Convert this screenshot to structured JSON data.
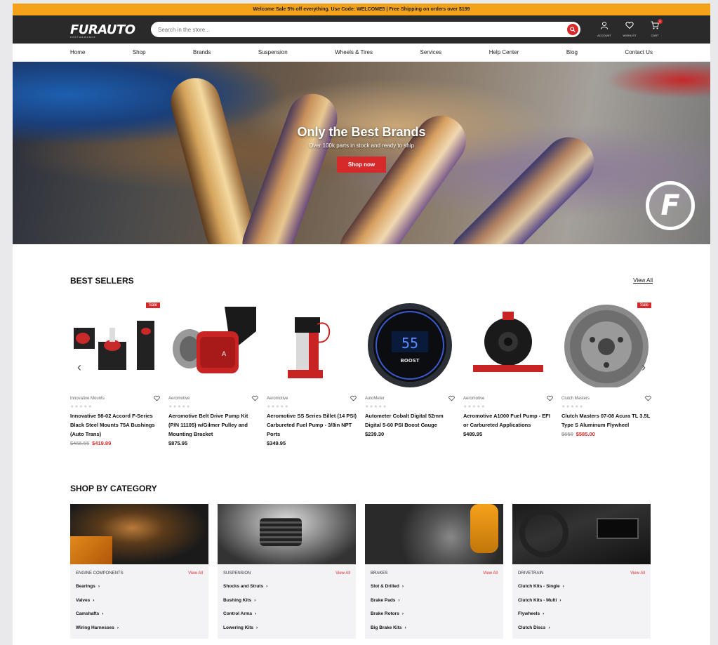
{
  "promo": {
    "text": "Welcome Sale 5% off everything. Use Code: WELCOME5 | Free Shipping on orders over $199"
  },
  "header": {
    "logo": "FURAUTO",
    "logo_tag": "PERFORMANCE",
    "search_placeholder": "Search in the store...",
    "icons": [
      {
        "label": "ACCOUNT",
        "icon": "user-icon"
      },
      {
        "label": "WISHLIST",
        "icon": "heart-icon"
      },
      {
        "label": "CART",
        "icon": "cart-icon",
        "count": "0"
      }
    ]
  },
  "nav": {
    "items": [
      "Home",
      "Shop",
      "Brands",
      "Suspension",
      "Wheels & Tires",
      "Services",
      "Help Center",
      "Blog",
      "Contact Us"
    ]
  },
  "hero": {
    "title": "Only the Best Brands",
    "subtitle": "Over 100k parts in stock and ready to ship",
    "button": "Shop now",
    "logo_letter": "F"
  },
  "best_sellers": {
    "title": "BEST SELLERS",
    "view_all": "View All",
    "products": [
      {
        "brand": "Innovative Mounts",
        "name": "Innovative 98-02 Accord F-Series Black Steel Mounts 75A Bushings (Auto Trans)",
        "old_price": "$466.55",
        "price": "$419.89",
        "sale": "Sale"
      },
      {
        "brand": "Aeromotive",
        "name": "Aeromotive Belt Drive Pump Kit (P/N 11105) w/Gilmer Pulley and Mounting Bracket",
        "old_price": "",
        "price": "$875.95",
        "sale": ""
      },
      {
        "brand": "Aeromotive",
        "name": "Aeromotive SS Series Billet (14 PSI) Carbureted Fuel Pump - 3/8in NPT Ports",
        "old_price": "",
        "price": "$349.95",
        "sale": ""
      },
      {
        "brand": "AutoMeter",
        "name": "Autometer Cobalt Digital 52mm Digital 5-60 PSI Boost Gauge",
        "old_price": "",
        "price": "$239.30",
        "sale": ""
      },
      {
        "brand": "Aeromotive",
        "name": "Aeromotive A1000 Fuel Pump - EFI or Carbureted Applications",
        "old_price": "",
        "price": "$489.95",
        "sale": ""
      },
      {
        "brand": "Clutch Masters",
        "name": "Clutch Masters 07-08 Acura TL 3.5L Type S Aluminum Flywheel",
        "old_price": "$650",
        "price": "$585.00",
        "sale": "Sale"
      }
    ],
    "stars": "★★★★★",
    "gauge_value": "55",
    "gauge_label": "BOOST"
  },
  "categories": {
    "title": "SHOP BY CATEGORY",
    "items": [
      {
        "name": "ENGINE COMPONENTS",
        "view_all": "View All",
        "links": [
          "Bearings",
          "Valves",
          "Camshafts",
          "Wiring Harnesses"
        ]
      },
      {
        "name": "SUSPENSION",
        "view_all": "View All",
        "links": [
          "Shocks and Struts",
          "Bushing Kits",
          "Control Arms",
          "Lowering Kits"
        ]
      },
      {
        "name": "BRAKES",
        "view_all": "View All",
        "links": [
          "Slot & Drilled",
          "Brake Pads",
          "Brake Rotors",
          "Big Brake Kits"
        ]
      },
      {
        "name": "DRIVETRAIN",
        "view_all": "View All",
        "links": [
          "Clutch Kits - Single",
          "Clutch Kits - Multi",
          "Flywheels",
          "Clutch Discs"
        ]
      }
    ]
  },
  "colors": {
    "accent": "#d62a2a",
    "promo": "#f5a21b",
    "header": "#2a2a2a"
  }
}
